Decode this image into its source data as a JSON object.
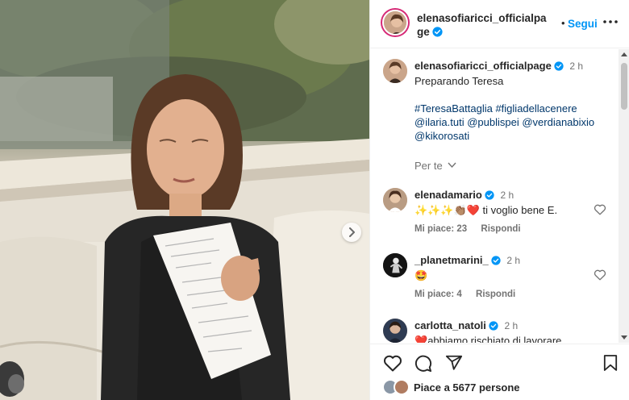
{
  "post": {
    "author": "elenasofiaricci_officialpage",
    "follow_label": "Segui",
    "separator": "•",
    "caption_time": "2 h",
    "caption_text": "Preparando Teresa",
    "caption_tags_line1": "#TeresaBattaglia #figliadellacenere",
    "caption_tags_line2": "@ilaria.tuti @publispei @verdianabixio",
    "caption_tags_line3": "@kikorosati",
    "per_te_label": "Per te"
  },
  "comments": [
    {
      "user": "elenadamario",
      "time": "2 h",
      "emojis": "✨✨✨👏🏽❤️",
      "text": " ti voglio bene E.",
      "likes_label": "Mi piace: 23",
      "reply_label": "Rispondi"
    },
    {
      "user": "_planetmarini_",
      "time": "2 h",
      "emojis": "🤩",
      "text": "",
      "likes_label": "Mi piace: 4",
      "reply_label": "Rispondi"
    },
    {
      "user": "carlotta_natoli",
      "time": "2 h",
      "emojis": "❤️",
      "text": "abbiamo rischiato di lavorare",
      "likes_label": "",
      "reply_label": ""
    }
  ],
  "footer": {
    "likes_text": "Piace a 5677 persone"
  },
  "icons": {
    "verified_color": "#0095f6",
    "accent": "#0095f6",
    "heart": "heart-icon",
    "comment": "comment-icon",
    "share": "share-icon",
    "save": "bookmark-icon",
    "more": "more-icon",
    "next": "chevron-right-icon"
  }
}
